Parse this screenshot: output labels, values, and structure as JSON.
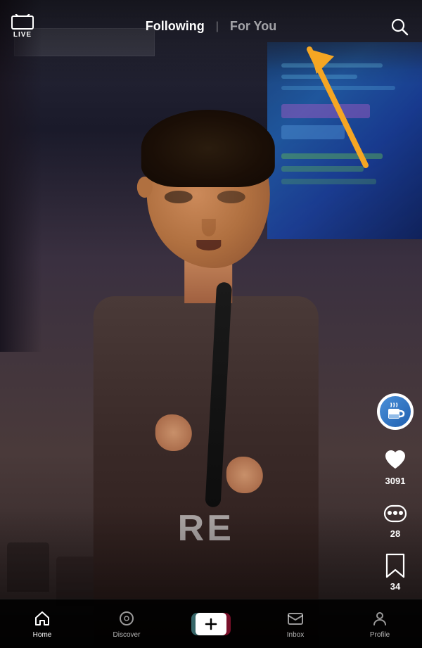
{
  "header": {
    "live_label": "LIVE",
    "following_label": "Following",
    "foryou_label": "For You",
    "divider": "|",
    "active_tab": "following"
  },
  "actions": {
    "like_count": "3091",
    "comment_count": "28",
    "bookmark_count": "34"
  },
  "bottom_nav": {
    "items": [
      {
        "label": "Home",
        "active": true
      },
      {
        "label": "Discover",
        "active": false
      },
      {
        "label": "",
        "active": false
      },
      {
        "label": "Inbox",
        "active": false
      },
      {
        "label": "Profile",
        "active": false
      }
    ]
  },
  "shirt_text": "RE",
  "colors": {
    "accent_yellow": "#F5A623",
    "tiktok_red": "#ee1d52",
    "tiktok_cyan": "#69c9d0",
    "white": "#ffffff"
  }
}
